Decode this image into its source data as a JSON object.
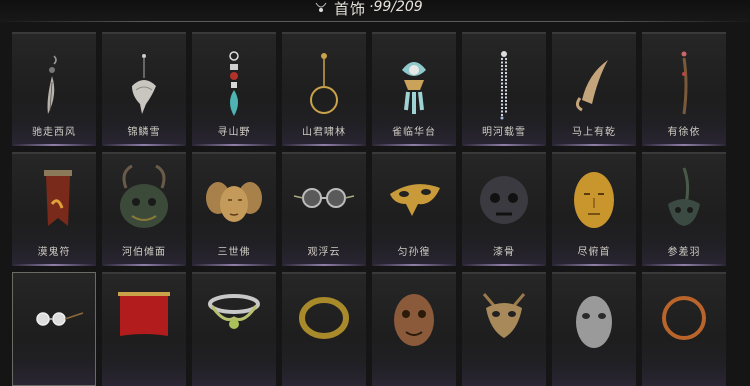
{
  "header": {
    "title": "首饰",
    "count": "·99/209",
    "icon": "necklace-icon"
  },
  "items": [
    {
      "label": "驰走西风",
      "icon": "feather-earring-icon"
    },
    {
      "label": "锦鳞雪",
      "icon": "fish-pendant-earring-icon"
    },
    {
      "label": "寻山野",
      "icon": "jade-drop-earring-icon"
    },
    {
      "label": "山君啸林",
      "icon": "hoop-earring-icon"
    },
    {
      "label": "雀临华台",
      "icon": "ornate-jeweled-earring-icon"
    },
    {
      "label": "明河载雪",
      "icon": "pearl-tassel-earring-icon"
    },
    {
      "label": "马上有乾",
      "icon": "horn-earring-icon"
    },
    {
      "label": "有徐依",
      "icon": "long-drop-earring-icon"
    },
    {
      "label": "漠鬼符",
      "icon": "talisman-banner-icon"
    },
    {
      "label": "河伯傩面",
      "icon": "horned-nuo-mask-icon"
    },
    {
      "label": "三世佛",
      "icon": "three-buddha-masks-icon"
    },
    {
      "label": "观浮云",
      "icon": "round-glasses-icon"
    },
    {
      "label": "匀孙徨",
      "icon": "golden-eye-mask-icon"
    },
    {
      "label": "漆骨",
      "icon": "dark-skull-mask-icon"
    },
    {
      "label": "尽俯首",
      "icon": "golden-face-mask-icon"
    },
    {
      "label": "参差羽",
      "icon": "feather-headpiece-icon"
    },
    {
      "label": "",
      "icon": "spectacles-icon"
    },
    {
      "label": "",
      "icon": "red-veil-icon"
    },
    {
      "label": "",
      "icon": "silver-crown-icon"
    },
    {
      "label": "",
      "icon": "gold-serpent-collar-icon"
    },
    {
      "label": "",
      "icon": "guardian-face-mask-icon"
    },
    {
      "label": "",
      "icon": "bronze-horned-mask-icon"
    },
    {
      "label": "",
      "icon": "silver-face-mask-icon"
    },
    {
      "label": "",
      "icon": "copper-ring-icon"
    }
  ],
  "colors": {
    "background": "#151515",
    "card": "#232323",
    "accent_glow": "#8e7fa8",
    "label": "#d0ccc4"
  }
}
